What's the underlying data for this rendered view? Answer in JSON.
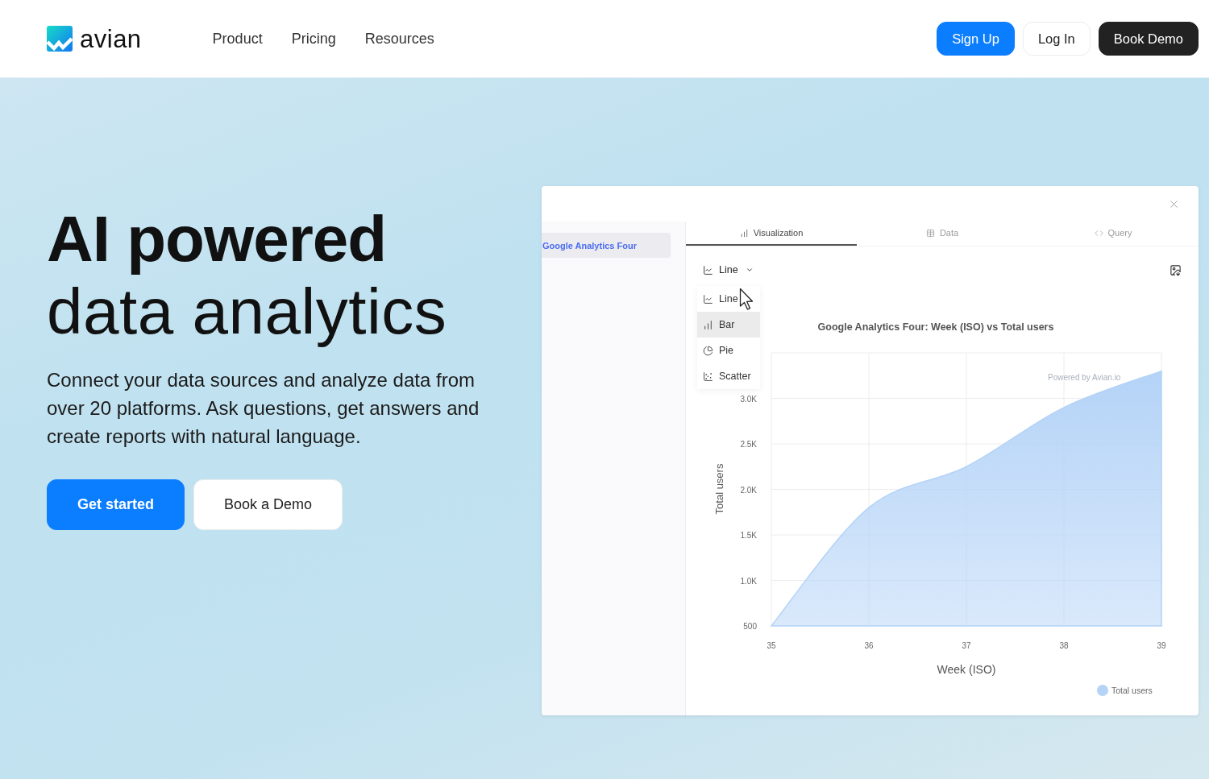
{
  "header": {
    "logo": {
      "text": "avian"
    },
    "nav": [
      "Product",
      "Pricing",
      "Resources"
    ],
    "buttons": [
      {
        "label": "Sign Up",
        "kind": "primary"
      },
      {
        "label": "Log In",
        "kind": "outline"
      },
      {
        "label": "Book Demo",
        "kind": "dark"
      }
    ]
  },
  "hero": {
    "title_lines": [
      {
        "text": "AI powered",
        "bold": true
      },
      {
        "text": "data analytics",
        "bold": false
      }
    ],
    "description_lines": [
      "Connect your data sources and analyze data from",
      "over 20 platforms. Ask questions, get answers and",
      "create reports with natural language."
    ],
    "buttons": [
      {
        "label": "Get started",
        "kind": "primary"
      },
      {
        "label": "Book a Demo",
        "kind": "outline"
      }
    ]
  },
  "preview": {
    "sidebar": {
      "items": [
        {
          "label": "Google Analytics Four",
          "selected": true
        }
      ]
    },
    "tabs": [
      {
        "label": "Visualization",
        "selected": true
      },
      {
        "label": "Data",
        "selected": false
      },
      {
        "label": "Query",
        "selected": false
      }
    ],
    "chart_type": {
      "label": "Line",
      "expanded": true,
      "options": [
        {
          "label": "Line",
          "highlighted": false
        },
        {
          "label": "Bar",
          "highlighted": true
        },
        {
          "label": "Pie",
          "highlighted": false
        },
        {
          "label": "Scatter",
          "highlighted": false
        }
      ]
    },
    "chart": {
      "credit": "Powered by Avian.io",
      "chart_data": {
        "type": "area",
        "title": "Google Analytics Four: Week (ISO) vs Total users",
        "xlabel": "Week (ISO)",
        "ylabel": "Total users",
        "x": [
          35,
          36,
          37,
          38,
          39
        ],
        "series": [
          {
            "name": "Total users",
            "color": "#b4d3f7",
            "values": [
              500,
              1800,
              2250,
              2900,
              3300
            ]
          }
        ],
        "xlim": [
          35,
          39
        ],
        "ylim": [
          500,
          3500
        ],
        "xticks": [
          35,
          36,
          37,
          38,
          39
        ],
        "yticks": [
          {
            "value": 500,
            "label": "500"
          },
          {
            "value": 1000,
            "label": "1.0K"
          },
          {
            "value": 1500,
            "label": "1.5K"
          },
          {
            "value": 2000,
            "label": "2.0K"
          },
          {
            "value": 2500,
            "label": "2.5K"
          },
          {
            "value": 3000,
            "label": "3.0K"
          }
        ],
        "grid": true
      }
    }
  }
}
